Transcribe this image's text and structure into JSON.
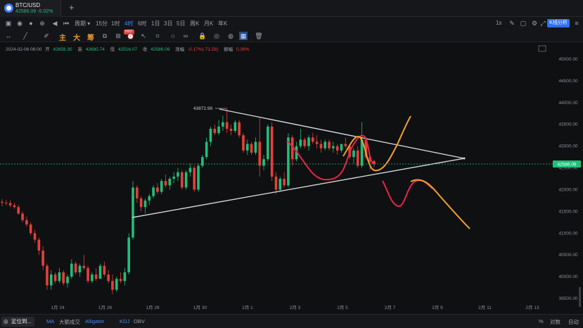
{
  "tab": {
    "title": "BTC/USD",
    "price": "42586.09",
    "change": "-0.02%",
    "add": "+"
  },
  "toolbar1": {
    "period_label": "周期",
    "intervals": [
      "15分",
      "1时",
      "4时",
      "6时",
      "1日",
      "3日",
      "5日",
      "周K",
      "月K",
      "年K"
    ],
    "active_interval": "4时",
    "realtime": "1s",
    "kline_analysis": "K线分析"
  },
  "toolbar2": {
    "main": "主",
    "big": "大",
    "chip": "筹",
    "hot": "HOT"
  },
  "ohlc": {
    "date": "2024-02-06 08:00",
    "open_label": "开",
    "open": "42658.30",
    "high_label": "高",
    "high": "42680.74",
    "low_label": "低",
    "low": "42516.07",
    "close_label": "收",
    "close": "42586.09",
    "change_label": "涨幅",
    "change": "-0.17%(-71.58)",
    "amp_label": "振幅",
    "amp": "0.39%"
  },
  "chart_data": {
    "type": "candlestick",
    "symbol": "BTC/USD",
    "interval": "4时",
    "ylim": [
      39500,
      45000
    ],
    "y_ticks": [
      "45000.00",
      "44500.00",
      "44000.00",
      "43500.00",
      "43000.00",
      "42500.00",
      "42000.00",
      "41500.00",
      "41000.00",
      "40500.00",
      "40000.00",
      "39500.00"
    ],
    "x_ticks": [
      "1月 24",
      "1月 26",
      "1月 28",
      "1月 30",
      "2月 1",
      "2月 3",
      "2月 5",
      "2月 7",
      "2月 9",
      "2月 11",
      "2月 13"
    ],
    "current_price": "42586.09",
    "peak_label": "43872.99",
    "grid": false,
    "candles": [
      [
        41720,
        41780,
        41620,
        41700
      ],
      [
        41700,
        41760,
        41640,
        41690
      ],
      [
        41690,
        41750,
        41600,
        41640
      ],
      [
        41640,
        41700,
        41560,
        41600
      ],
      [
        41600,
        41650,
        41420,
        41450
      ],
      [
        41450,
        41500,
        41250,
        41300
      ],
      [
        41300,
        41380,
        41150,
        41200
      ],
      [
        41200,
        41250,
        40950,
        41000
      ],
      [
        41000,
        41080,
        40780,
        40850
      ],
      [
        40850,
        40900,
        40500,
        40600
      ],
      [
        40600,
        40700,
        40150,
        40250
      ],
      [
        40250,
        40300,
        39700,
        39800
      ],
      [
        39800,
        40150,
        39700,
        40050
      ],
      [
        40050,
        40100,
        39850,
        39900
      ],
      [
        39900,
        40200,
        39850,
        40100
      ],
      [
        40100,
        40150,
        39800,
        39850
      ],
      [
        39850,
        40050,
        39750,
        40000
      ],
      [
        40000,
        40400,
        39950,
        40300
      ],
      [
        40300,
        40350,
        40050,
        40100
      ],
      [
        40100,
        40300,
        40000,
        40250
      ],
      [
        40250,
        40500,
        40150,
        40200
      ],
      [
        40200,
        40250,
        39850,
        39900
      ],
      [
        39900,
        40100,
        39850,
        40050
      ],
      [
        40050,
        40200,
        39900,
        39950
      ],
      [
        39950,
        40300,
        39950,
        40250
      ],
      [
        40250,
        40350,
        40000,
        40050
      ],
      [
        40050,
        40150,
        39850,
        39900
      ],
      [
        39900,
        40050,
        39600,
        39700
      ],
      [
        39700,
        40000,
        39650,
        39950
      ],
      [
        39950,
        40100,
        39850,
        39900
      ],
      [
        39900,
        40200,
        39800,
        40100
      ],
      [
        40100,
        41000,
        40050,
        40900
      ],
      [
        40900,
        42200,
        40850,
        42050
      ],
      [
        42050,
        42100,
        41700,
        41800
      ],
      [
        41800,
        41850,
        41500,
        41600
      ],
      [
        41600,
        41800,
        41450,
        41750
      ],
      [
        41750,
        41900,
        41650,
        41850
      ],
      [
        41850,
        42100,
        41800,
        42050
      ],
      [
        42050,
        42150,
        41900,
        41950
      ],
      [
        41950,
        42250,
        41900,
        42200
      ],
      [
        42200,
        42350,
        42050,
        42100
      ],
      [
        42100,
        42300,
        42000,
        42250
      ],
      [
        42250,
        42400,
        42150,
        42300
      ],
      [
        42300,
        42500,
        42200,
        42400
      ],
      [
        42400,
        42450,
        42000,
        42050
      ],
      [
        42050,
        42450,
        42000,
        42400
      ],
      [
        42400,
        42600,
        42300,
        42500
      ],
      [
        42500,
        42550,
        41950,
        42000
      ],
      [
        42000,
        42600,
        41950,
        42550
      ],
      [
        42550,
        42800,
        42500,
        42750
      ],
      [
        42750,
        43200,
        42700,
        43100
      ],
      [
        43100,
        43450,
        43000,
        43400
      ],
      [
        43400,
        43500,
        43250,
        43300
      ],
      [
        43300,
        43600,
        43250,
        43450
      ],
      [
        43450,
        43700,
        43350,
        43550
      ],
      [
        43550,
        43873,
        43300,
        43400
      ],
      [
        43400,
        43500,
        43250,
        43350
      ],
      [
        43350,
        43600,
        43300,
        43550
      ],
      [
        43550,
        43600,
        43200,
        43250
      ],
      [
        43250,
        43300,
        42850,
        42900
      ],
      [
        42900,
        43150,
        42800,
        43050
      ],
      [
        43050,
        43100,
        42800,
        42850
      ],
      [
        42850,
        43200,
        42800,
        43100
      ],
      [
        43100,
        43650,
        42300,
        42550
      ],
      [
        42550,
        42800,
        42450,
        42700
      ],
      [
        42700,
        43500,
        42650,
        43450
      ],
      [
        43450,
        43550,
        42200,
        42300
      ],
      [
        42300,
        42400,
        41900,
        42000
      ],
      [
        42000,
        42300,
        41950,
        42250
      ],
      [
        42250,
        42400,
        42050,
        42100
      ],
      [
        42100,
        43300,
        42050,
        43200
      ],
      [
        43200,
        43250,
        42550,
        42700
      ],
      [
        42700,
        43100,
        42650,
        43000
      ],
      [
        43000,
        43400,
        42950,
        43150
      ],
      [
        43150,
        43200,
        42950,
        43000
      ],
      [
        43000,
        43250,
        42900,
        43200
      ],
      [
        43200,
        43300,
        43050,
        43100
      ],
      [
        43100,
        43250,
        42950,
        43050
      ],
      [
        43050,
        43150,
        42850,
        42950
      ],
      [
        42950,
        43150,
        42900,
        43100
      ],
      [
        43100,
        43150,
        42900,
        42950
      ],
      [
        42950,
        43100,
        42850,
        43000
      ],
      [
        43000,
        43050,
        42800,
        42900
      ],
      [
        42900,
        43050,
        42850,
        43050
      ],
      [
        43050,
        43200,
        42950,
        43000
      ],
      [
        43000,
        43050,
        42700,
        42750
      ],
      [
        42750,
        42950,
        42600,
        42900
      ],
      [
        42900,
        43000,
        42500,
        42550
      ],
      [
        42550,
        43550,
        42500,
        43150
      ],
      [
        43150,
        43200,
        42700,
        42750
      ],
      [
        42750,
        42800,
        42450,
        42650
      ],
      [
        42658,
        42681,
        42516,
        42586
      ]
    ]
  },
  "bottombar": {
    "locate": "定位到...",
    "indicators": [
      "MA",
      "大额成交",
      "Alligator",
      "KDJ",
      "OBV"
    ],
    "right": [
      "%",
      "对数",
      "自动"
    ]
  }
}
